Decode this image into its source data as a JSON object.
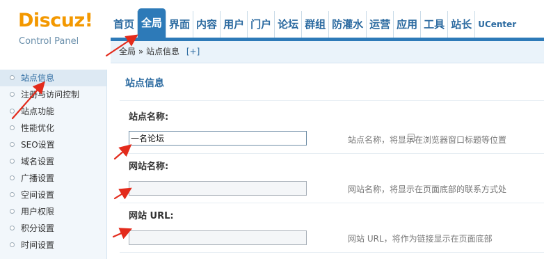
{
  "logo": {
    "text": "Discuz!",
    "subtitle": "Control Panel"
  },
  "nav": {
    "items": [
      {
        "label": "首页",
        "active": false
      },
      {
        "label": "全局",
        "active": true
      },
      {
        "label": "界面",
        "active": false
      },
      {
        "label": "内容",
        "active": false
      },
      {
        "label": "用户",
        "active": false
      },
      {
        "label": "门户",
        "active": false
      },
      {
        "label": "论坛",
        "active": false
      },
      {
        "label": "群组",
        "active": false
      },
      {
        "label": "防灌水",
        "active": false
      },
      {
        "label": "运营",
        "active": false
      },
      {
        "label": "应用",
        "active": false
      },
      {
        "label": "工具",
        "active": false
      },
      {
        "label": "站长",
        "active": false
      },
      {
        "label": "UCenter",
        "active": false
      }
    ]
  },
  "breadcrumb": {
    "root": "全局",
    "separator": "»",
    "current": "站点信息",
    "add_label": "[+]"
  },
  "sidebar": {
    "items": [
      {
        "label": "站点信息",
        "active": true
      },
      {
        "label": "注册与访问控制",
        "active": false
      },
      {
        "label": "站点功能",
        "active": false
      },
      {
        "label": "性能优化",
        "active": false
      },
      {
        "label": "SEO设置",
        "active": false
      },
      {
        "label": "域名设置",
        "active": false
      },
      {
        "label": "广播设置",
        "active": false
      },
      {
        "label": "空间设置",
        "active": false
      },
      {
        "label": "用户权限",
        "active": false
      },
      {
        "label": "积分设置",
        "active": false
      },
      {
        "label": "时间设置",
        "active": false
      }
    ]
  },
  "main": {
    "title": "站点信息",
    "fields": [
      {
        "label": "站点名称:",
        "value": "一名论坛",
        "hint": "站点名称，将显示在浏览器窗口标题等位置"
      },
      {
        "label": "网站名称:",
        "value": "",
        "hint": "网站名称，将显示在页面底部的联系方式处"
      },
      {
        "label": "网站 URL:",
        "value": "",
        "hint": "网站 URL，将作为链接显示在页面底部"
      }
    ]
  },
  "colors": {
    "brand_orange": "#f39800",
    "nav_blue": "#2d7ab8",
    "arrow_red": "#e32b1c"
  },
  "icons": {
    "input_field_icon": "document-icon",
    "sidebar_bullet": "circle-bullet-icon"
  }
}
